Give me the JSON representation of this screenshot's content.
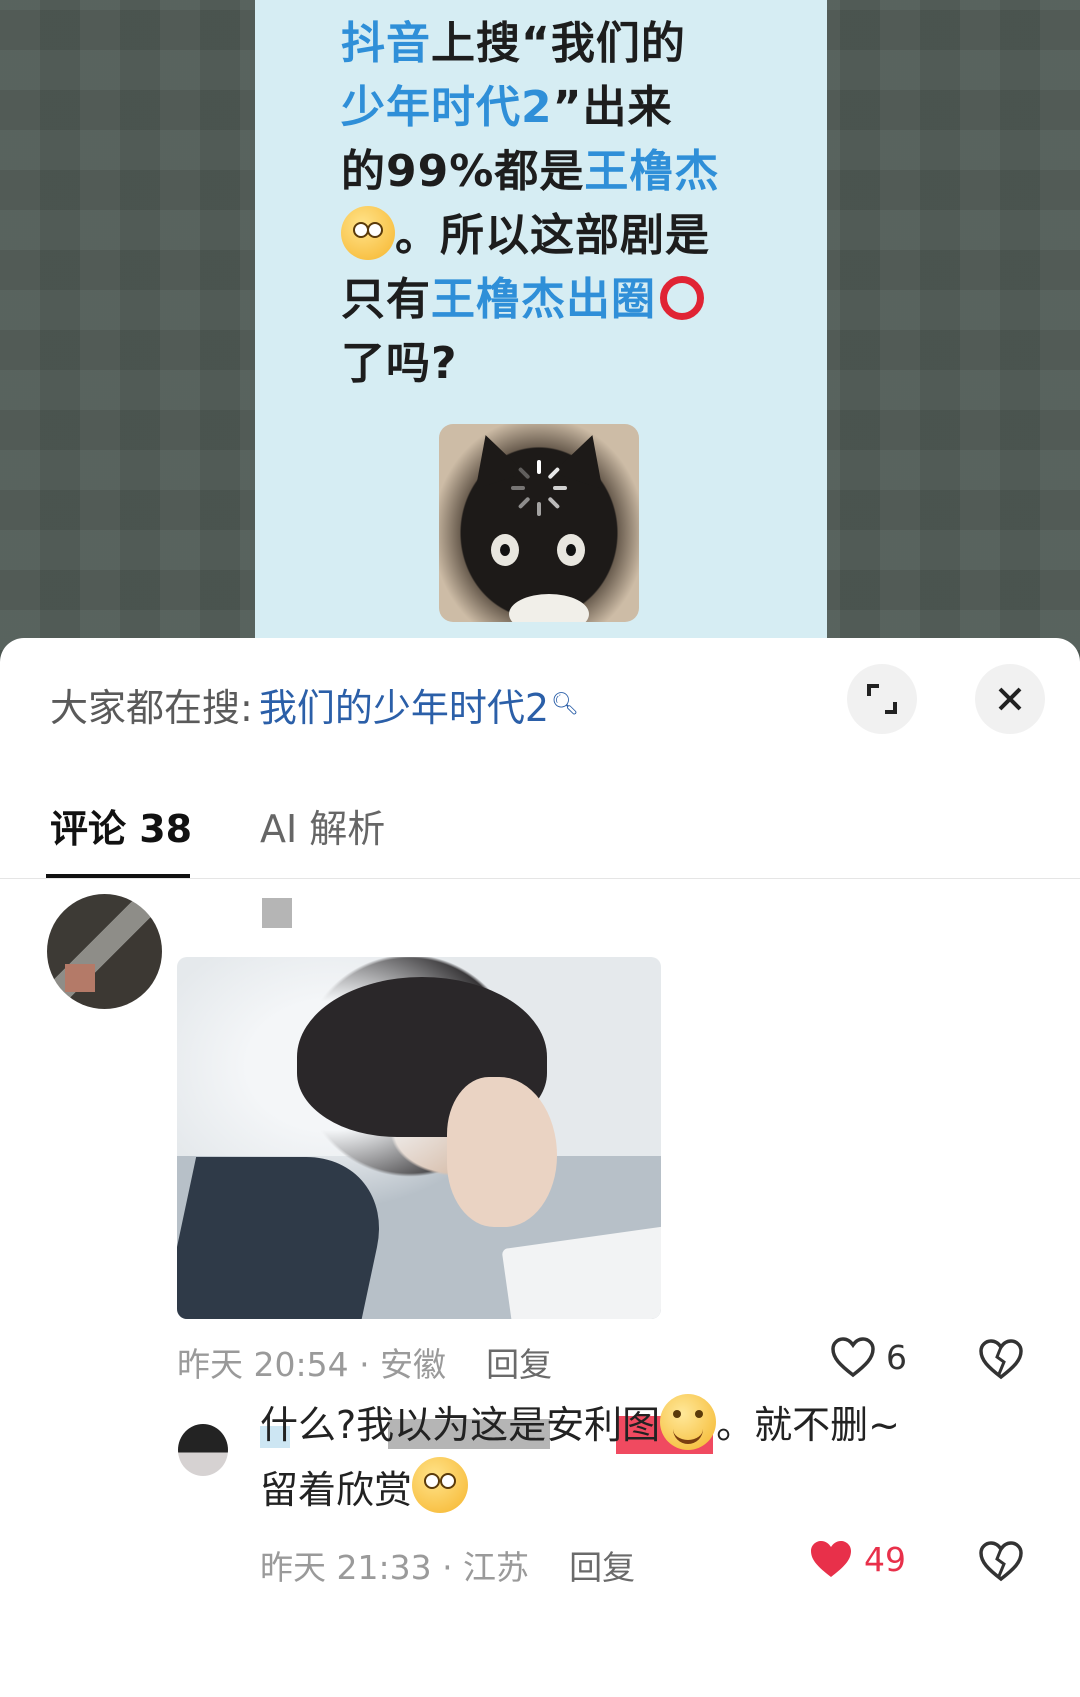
{
  "post": {
    "line1_hl": "抖音",
    "line1_rest": "上搜“我们的",
    "line2_hl": "少年时代2",
    "line2_rest": "”出来",
    "line3_a": "的99%都是",
    "line3_hl": "王橹杰",
    "line4": "。所以这部剧是",
    "line5_a": "只有",
    "line5_hl": "王橹杰出圈",
    "line6": "了吗?"
  },
  "search_bar": {
    "prefix": "大家都在搜:",
    "query": "我们的少年时代2"
  },
  "tabs": {
    "comments": "评论 38",
    "ai": "AI 解析"
  },
  "comment1": {
    "date": "昨天 20:54 · 安徽",
    "reply": "回复",
    "likes": "6"
  },
  "reply1": {
    "text_a": "什么?我以为这是安利图",
    "text_b": "。就不删~",
    "text_c": "留着欣赏",
    "date": "昨天 21:33 · 江苏",
    "reply": "回复",
    "likes": "49"
  },
  "colors": {
    "link": "#2b5fa8",
    "highlight": "#2f8fd8",
    "like_active": "#e8304a"
  }
}
